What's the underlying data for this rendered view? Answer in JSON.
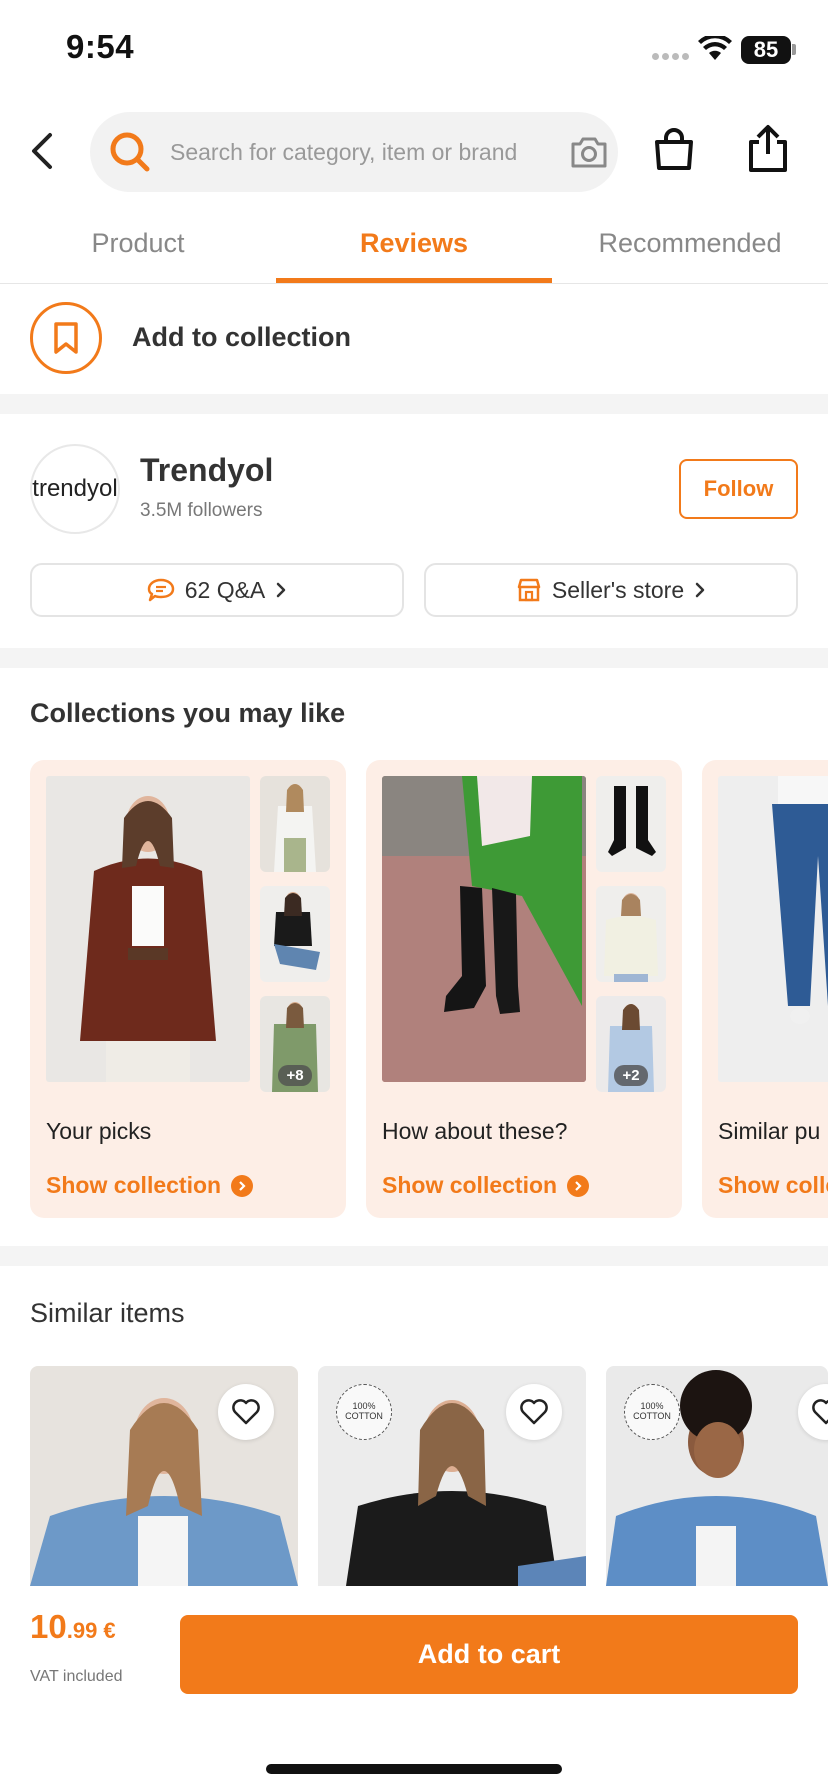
{
  "status": {
    "time": "9:54",
    "battery": "85"
  },
  "header": {
    "search_placeholder": "Search for category, item or brand"
  },
  "tabs": [
    {
      "label": "Product",
      "active": false
    },
    {
      "label": "Reviews",
      "active": true
    },
    {
      "label": "Recommended",
      "active": false
    }
  ],
  "collection_action": {
    "label": "Add to collection"
  },
  "seller": {
    "logo_text": "trendyol",
    "name": "Trendyol",
    "followers": "3.5M followers",
    "follow_label": "Follow",
    "qa_label": "62 Q&A",
    "store_label": "Seller's store"
  },
  "collections": {
    "title": "Collections you may like",
    "items": [
      {
        "title": "Your picks",
        "link": "Show collection",
        "extra": "+8"
      },
      {
        "title": "How about these?",
        "link": "Show collection",
        "extra": "+2"
      },
      {
        "title": "Similar pu",
        "link": "Show colle"
      }
    ]
  },
  "similar": {
    "title": "Similar items",
    "cotton_badge": "100% COTTON"
  },
  "purchase": {
    "price_main": "10",
    "price_cents": ".99 €",
    "vat": "VAT included",
    "add_to_cart": "Add to cart"
  },
  "colors": {
    "accent": "#f27a1a",
    "card_bg": "#fdeee6"
  }
}
